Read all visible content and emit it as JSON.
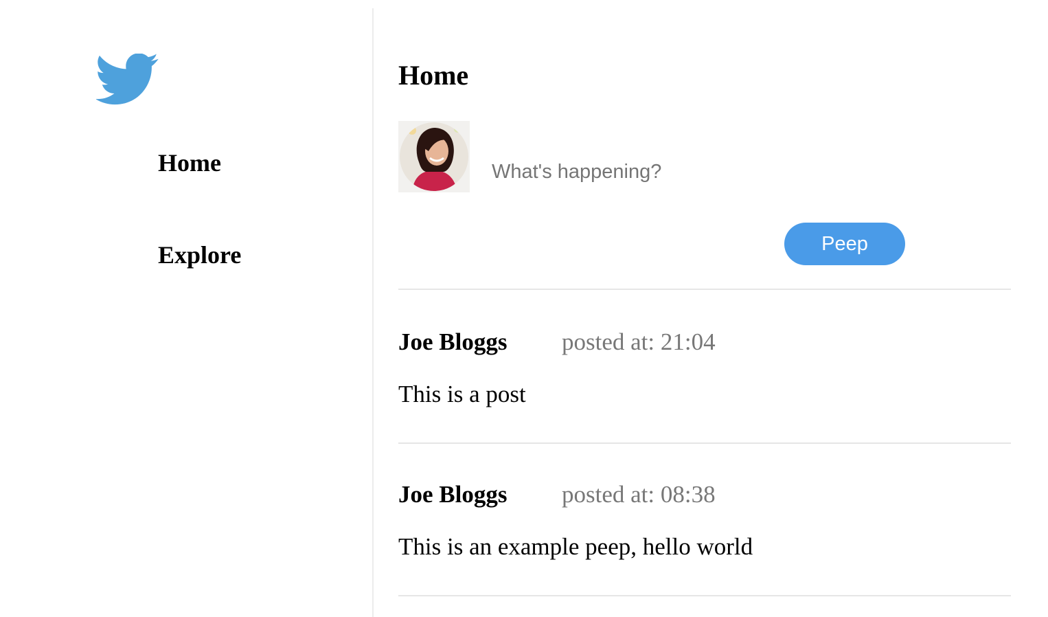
{
  "sidebar": {
    "logo_icon": "twitter-bird-icon",
    "brand_color": "#4ea1dc",
    "nav": [
      {
        "label": "Home"
      },
      {
        "label": "Explore"
      }
    ]
  },
  "main": {
    "title": "Home",
    "composer": {
      "avatar_icon": "user-avatar-photo",
      "placeholder": "What's happening?",
      "value": "",
      "submit_label": "Peep",
      "submit_color": "#4a9be8"
    },
    "posts": [
      {
        "author": "Joe Bloggs",
        "timestamp": "posted at: 21:04",
        "body": "This is a post"
      },
      {
        "author": "Joe Bloggs",
        "timestamp": "posted at: 08:38",
        "body": "This is an example peep, hello world"
      }
    ]
  }
}
